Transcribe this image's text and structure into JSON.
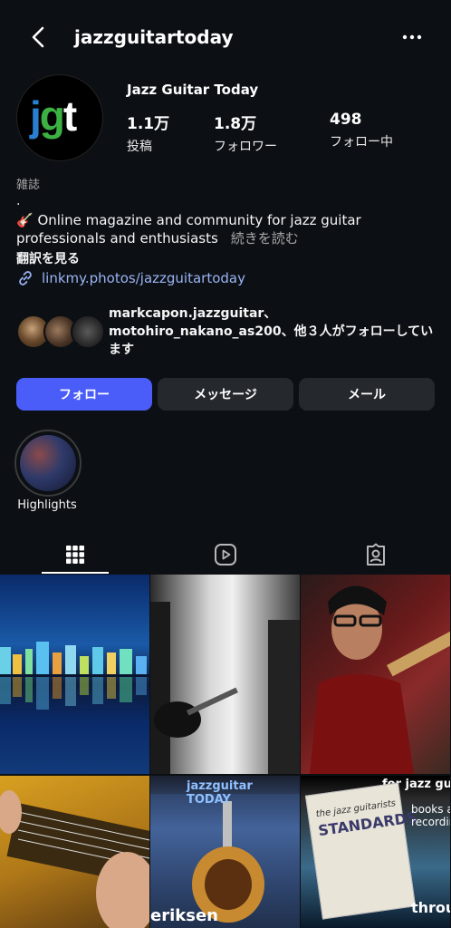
{
  "header": {
    "username": "jazzguitartoday"
  },
  "profile": {
    "avatar_letters": {
      "j": "j",
      "g": "g",
      "t": "t"
    },
    "display_name": "Jazz Guitar Today",
    "stats": [
      {
        "value": "1.1万",
        "label": "投稿"
      },
      {
        "value": "1.8万",
        "label": "フォロワー"
      },
      {
        "value": "498",
        "label": "フォロー中"
      }
    ],
    "category": "雑誌",
    "dot": ".",
    "bio_emoji": "🎸",
    "bio": " Online magazine and community for jazz guitar professionals and enthusiasts",
    "bio_more": "続きを読む",
    "translate": "翻訳を見る",
    "link": "linkmy.photos/jazzguitartoday"
  },
  "followed_by": {
    "text": "markcapon.jazzguitar、motohiro_nakano_as200、他３人がフォローしています"
  },
  "actions": {
    "follow": "フォロー",
    "message": "メッセージ",
    "mail": "メール"
  },
  "highlights": [
    {
      "label": "Highlights"
    }
  ],
  "posts": {
    "cell5_overlay_top": "jazzguitar TODAY",
    "cell5_overlay_bottom": "eriksen",
    "cell6_overlay_top": "for jazz guitar",
    "cell6_side_text": "books a recordin",
    "cell6_book_small": "the jazz guitarists",
    "cell6_book_title": "STANDARDS",
    "cell6_bottom": "throu"
  },
  "colors": {
    "background": "#0c1014",
    "follow_button": "#4a5df9",
    "secondary_button": "#25292e",
    "link": "#9bb3f5"
  }
}
